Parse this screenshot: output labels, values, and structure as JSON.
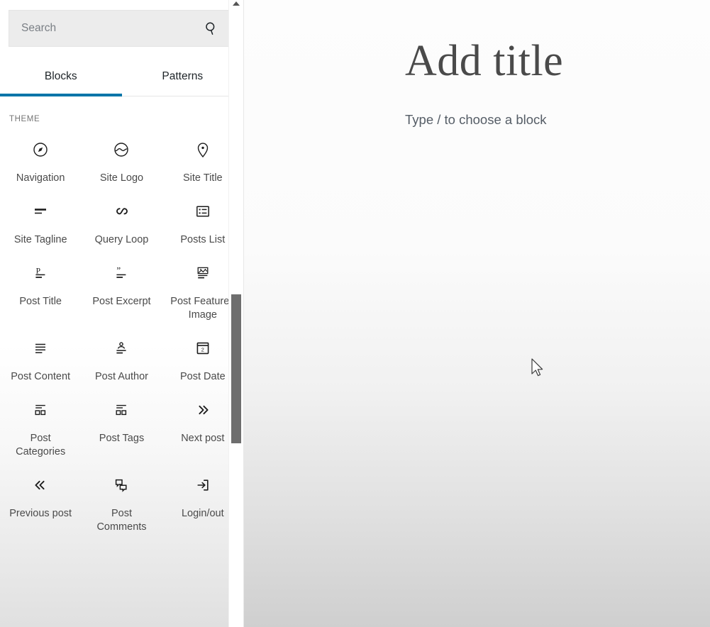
{
  "inserter": {
    "search": {
      "placeholder": "Search",
      "value": "",
      "icon": "search-icon"
    },
    "tabs": [
      {
        "label": "Blocks",
        "active": true
      },
      {
        "label": "Patterns",
        "active": false
      }
    ],
    "section_heading": "THEME",
    "accent_color": "#0075a9",
    "blocks": [
      {
        "label": "Navigation",
        "icon": "compass-icon"
      },
      {
        "label": "Site Logo",
        "icon": "site-logo-icon"
      },
      {
        "label": "Site Title",
        "icon": "map-pin-icon"
      },
      {
        "label": "Site Tagline",
        "icon": "tagline-lines-icon"
      },
      {
        "label": "Query Loop",
        "icon": "loop-infinity-icon"
      },
      {
        "label": "Posts List",
        "icon": "list-view-icon"
      },
      {
        "label": "Post Title",
        "icon": "post-title-icon"
      },
      {
        "label": "Post Excerpt",
        "icon": "quote-excerpt-icon"
      },
      {
        "label": "Post Featured Image",
        "icon": "featured-image-icon"
      },
      {
        "label": "Post Content",
        "icon": "content-lines-icon"
      },
      {
        "label": "Post Author",
        "icon": "author-person-icon"
      },
      {
        "label": "Post Date",
        "icon": "calendar-icon"
      },
      {
        "label": "Post Categories",
        "icon": "categories-icon"
      },
      {
        "label": "Post Tags",
        "icon": "tags-icon"
      },
      {
        "label": "Next post",
        "icon": "chevron-double-right-icon"
      },
      {
        "label": "Previous post",
        "icon": "chevron-double-left-icon"
      },
      {
        "label": "Post Comments",
        "icon": "comments-bubbles-icon"
      },
      {
        "label": "Login/out",
        "icon": "login-arrow-icon"
      }
    ]
  },
  "editor": {
    "title_placeholder": "Add title",
    "title_value": "",
    "body_placeholder": "Type / to choose a block"
  }
}
